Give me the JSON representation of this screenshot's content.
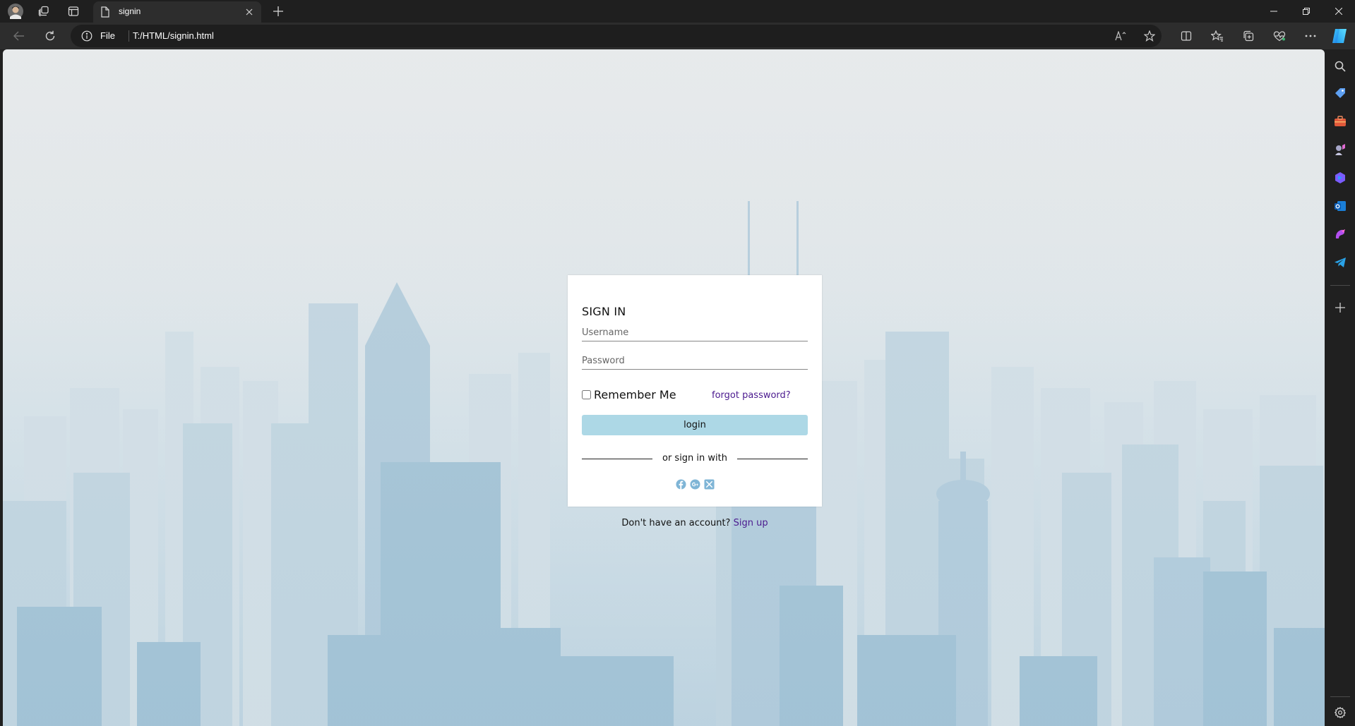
{
  "browser": {
    "tab_title": "signin",
    "address_scheme": "File",
    "address_url": "T:/HTML/signin.html",
    "read_aloud_label": "Aˆ"
  },
  "form": {
    "title": "SIGN IN",
    "username_placeholder": "Username",
    "password_placeholder": "Password",
    "remember_label": "Remember Me",
    "forgot_label": "forgot password?",
    "login_label": "login",
    "or_text": "or sign in with",
    "social": [
      "facebook-icon",
      "google-plus-icon",
      "x-twitter-icon"
    ],
    "signup_prompt": "Don't have an account?",
    "signup_link": "Sign up"
  },
  "colors": {
    "login_button": "#add8e6",
    "link": "#4b1a8f",
    "social_icon": "#7fb5d6"
  }
}
